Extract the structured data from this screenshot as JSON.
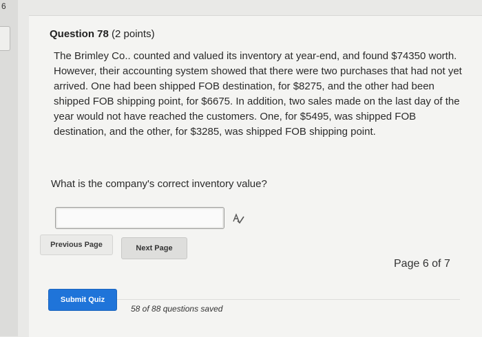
{
  "sidebar": {
    "tab_number": "6"
  },
  "question": {
    "label": "Question 78",
    "points": "(2 points)",
    "body": "The Brimley Co.. counted and valued its inventory at year-end, and found $74350 worth. However, their accounting system showed that there were two purchases that had not yet arrived. One had been shipped FOB destination, for $8275, and the other had been shipped FOB shipping point, for $6675. In addition, two sales made on the last day of the year would not have reached the customers. One, for $5495, was shipped FOB destination, and the other, for $3285, was shipped FOB shipping point.",
    "prompt": "What is the company's correct inventory value?"
  },
  "answer": {
    "value": ""
  },
  "navigation": {
    "previous_label": "Previous Page",
    "next_label": "Next Page",
    "page_indicator": "Page 6 of 7"
  },
  "footer": {
    "submit_label": "Submit Quiz",
    "saved_status": "58 of 88 questions saved"
  },
  "colors": {
    "submit_button": "#1f74d9",
    "page_background": "#f4f4f2"
  }
}
